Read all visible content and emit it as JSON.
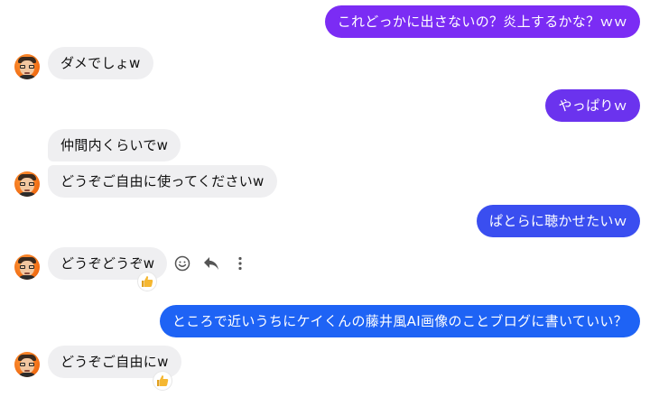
{
  "messages": [
    {
      "text": "これどっかに出さないの？炎上するかな？ｗｗ",
      "color": "#7b2cf4"
    },
    {
      "text": "ダメでしょw"
    },
    {
      "text": "やっぱりｗ",
      "color": "#6b33ee"
    },
    {
      "text": "仲間内くらいでw"
    },
    {
      "text": "どうぞご自由に使ってくださいw"
    },
    {
      "text": "ぱとらに聴かせたいｗ",
      "color": "#3a4ef0"
    },
    {
      "text": "どうぞどうぞw",
      "reaction": "thumbs-up-emoji"
    },
    {
      "text": "ところで近いうちにケイくんの藤井風AI画像のことブログに書いていい？",
      "color": "#1e63f5"
    },
    {
      "text": "どうぞご自由にw",
      "reaction": "thumbs-up-emoji"
    }
  ],
  "message_tools": [
    "smiley-icon",
    "reply-icon",
    "more-options-icon"
  ],
  "colors": {
    "incoming_bubble": "#efeff1",
    "reaction_emoji": "#f5b731"
  }
}
